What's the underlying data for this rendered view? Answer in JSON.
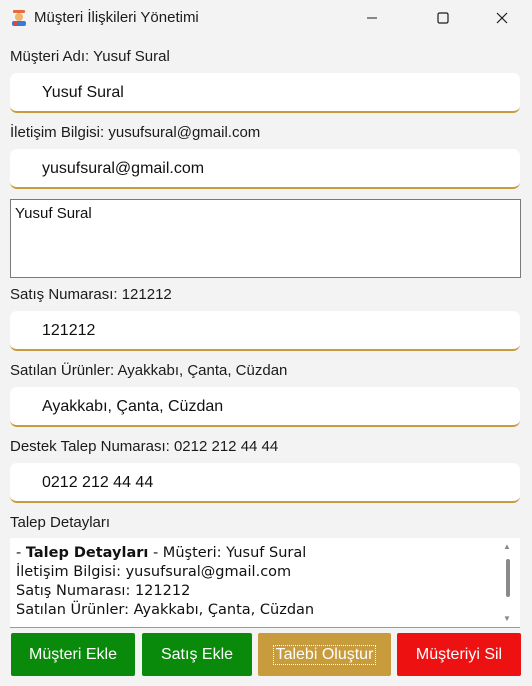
{
  "window": {
    "title": "Müşteri İlişkileri Yönetimi",
    "controls": {
      "minimize": "—",
      "maximize": "☐",
      "close": "✕"
    }
  },
  "customer": {
    "label": "Müşteri Adı: Yusuf Sural",
    "value": "Yusuf Sural"
  },
  "contact": {
    "label": "İletişim Bilgisi: yusufsural@gmail.com",
    "value": "yusufsural@gmail.com"
  },
  "notes": {
    "value": "Yusuf Sural"
  },
  "sale_number": {
    "label": "Satış Numarası: 121212",
    "value": "121212"
  },
  "products": {
    "label": "Satılan Ürünler: Ayakkabı,  Çanta,  Cüzdan",
    "value": "Ayakkabı, Çanta, Cüzdan"
  },
  "support": {
    "label": "Destek Talep Numarası: 0212 212 44 44",
    "value": "0212 212 44 44"
  },
  "details": {
    "label": "Talep Detayları",
    "line1_prefix": "- ",
    "line1_bold": "Talep Detayları",
    "line1_suffix": " - Müşteri: Yusuf Sural",
    "line2": "İletişim Bilgisi: yusufsural@gmail.com",
    "line3": "Satış Numarası: 121212",
    "line4": "Satılan Ürünler: Ayakkabı, Çanta, Cüzdan"
  },
  "buttons": {
    "add_customer": "Müşteri Ekle",
    "add_sale": "Satış Ekle",
    "create_request": "Talebi Oluştur",
    "delete_customer": "Müşteriyi Sil"
  },
  "colors": {
    "accent": "#c89b3c",
    "green": "#0a8a0a",
    "red": "#ee1111"
  }
}
